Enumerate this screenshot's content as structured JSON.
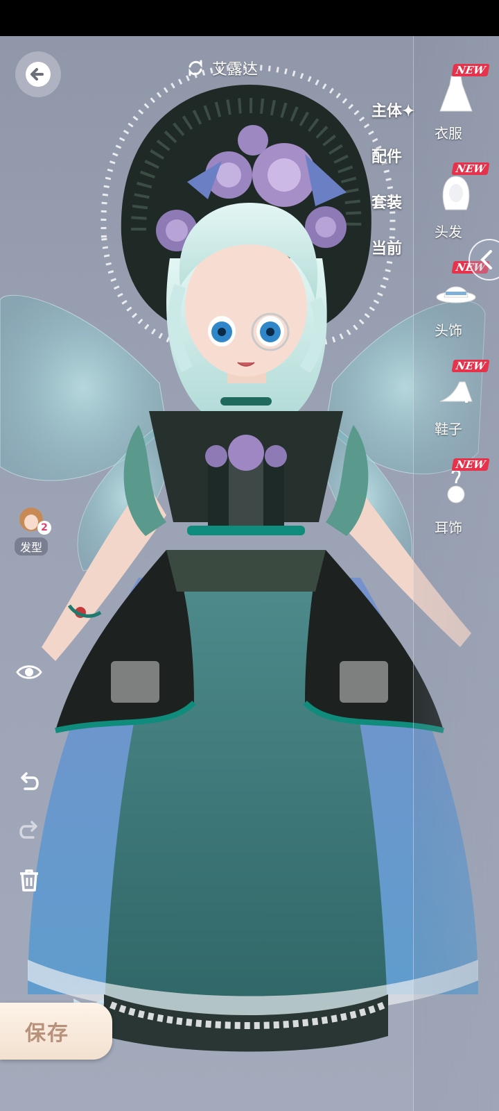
{
  "header": {
    "character_name": "艾露达",
    "back_icon": "back-arrow-icon",
    "swap_icon": "swap-character-icon"
  },
  "categories": {
    "items": [
      {
        "label": "主体✦",
        "active": true
      },
      {
        "label": "配件",
        "active": false
      },
      {
        "label": "套装",
        "active": false
      },
      {
        "label": "当前",
        "active": false
      }
    ]
  },
  "slots": {
    "items": [
      {
        "label": "衣服",
        "badge": "NEW",
        "icon": "dress-icon"
      },
      {
        "label": "头发",
        "badge": "NEW",
        "icon": "hair-icon"
      },
      {
        "label": "头饰",
        "badge": "NEW",
        "icon": "hat-icon"
      },
      {
        "label": "鞋子",
        "badge": "NEW",
        "icon": "shoe-icon"
      },
      {
        "label": "耳饰",
        "badge": "NEW",
        "icon": "earring-icon"
      }
    ]
  },
  "left_tools": {
    "hairstyle_label": "发型",
    "hairstyle_count": "2",
    "tools": [
      "eye-visibility-icon",
      "undo-icon",
      "redo-icon",
      "trash-icon"
    ]
  },
  "save": {
    "label": "保存"
  },
  "colors": {
    "badge_red": "#e6324b",
    "save_text": "#b8917a",
    "dress_teal": "#3f7e80",
    "skirt_blue": "#5b8fc4"
  }
}
